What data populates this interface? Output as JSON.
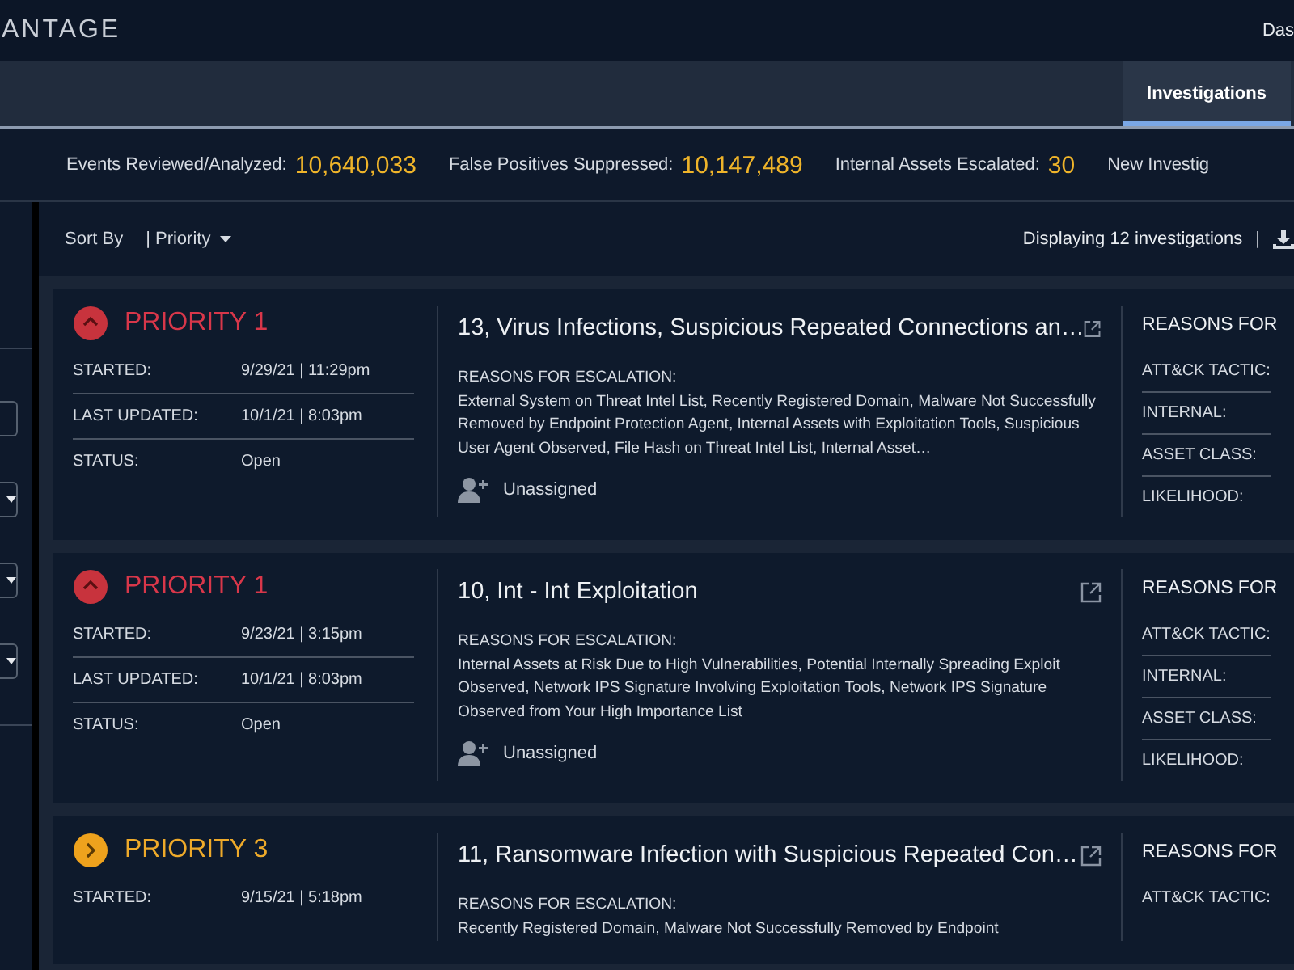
{
  "header": {
    "logo": "ANTAGE",
    "nav_link": "Das"
  },
  "tabs": [
    {
      "label": "Investigations",
      "selected": true
    }
  ],
  "stats": [
    {
      "label": "Events Reviewed/Analyzed:",
      "value": "10,640,033"
    },
    {
      "label": "False Positives Suppressed:",
      "value": "10,147,489"
    },
    {
      "label": "Internal Assets Escalated:",
      "value": "30"
    },
    {
      "label": "New Investig"
    }
  ],
  "toolbar": {
    "sort_label": "Sort By",
    "sort_value": "| Priority",
    "count": "Displaying 12 investigations",
    "separator": "|"
  },
  "investigations": [
    {
      "kind": "high",
      "priority": "PRIORITY 1",
      "fields": [
        {
          "label": "STARTED:",
          "value": "9/29/21 | 11:29pm"
        },
        {
          "label": "LAST UPDATED:",
          "value": "10/1/21 | 8:03pm"
        },
        {
          "label": "STATUS:",
          "value": "Open"
        }
      ],
      "title": "13, Virus Infections, Suspicious Repeated Connections an…",
      "reasons_label": "REASONS FOR ESCALATION:",
      "reasons": "External System on Threat Intel List, Recently Registered Domain, Malware Not Successfully Removed by Endpoint Protection Agent, Internal Assets with Exploitation Tools, Suspicious User Agent Observed, File Hash on Threat Intel List, Internal Asset…",
      "assignee": "Unassigned",
      "side_title": "REASONS FOR",
      "side_labels": [
        "ATT&CK TACTIC:",
        "INTERNAL:",
        "ASSET CLASS:",
        "LIKELIHOOD:"
      ]
    },
    {
      "kind": "high",
      "priority": "PRIORITY 1",
      "fields": [
        {
          "label": "STARTED:",
          "value": "9/23/21 | 3:15pm"
        },
        {
          "label": "LAST UPDATED:",
          "value": "10/1/21 | 8:03pm"
        },
        {
          "label": "STATUS:",
          "value": "Open"
        }
      ],
      "title": "10, Int - Int Exploitation",
      "reasons_label": "REASONS FOR ESCALATION:",
      "reasons": "Internal Assets at Risk Due to High Vulnerabilities, Potential Internally Spreading Exploit Observed, Network IPS Signature Involving Exploitation Tools, Network IPS Signature Observed from Your High Importance List",
      "assignee": "Unassigned",
      "side_title": "REASONS FOR",
      "side_labels": [
        "ATT&CK TACTIC:",
        "INTERNAL:",
        "ASSET CLASS:",
        "LIKELIHOOD:"
      ]
    },
    {
      "kind": "medium",
      "priority": "PRIORITY 3",
      "fields": [
        {
          "label": "STARTED:",
          "value": "9/15/21 | 5:18pm"
        }
      ],
      "title": "11, Ransomware Infection with Suspicious Repeated Con…",
      "reasons_label": "REASONS FOR ESCALATION:",
      "reasons": "Recently Registered Domain, Malware Not Successfully Removed by Endpoint",
      "side_title": "REASONS FOR",
      "side_labels": [
        "ATT&CK TACTIC:"
      ]
    }
  ]
}
